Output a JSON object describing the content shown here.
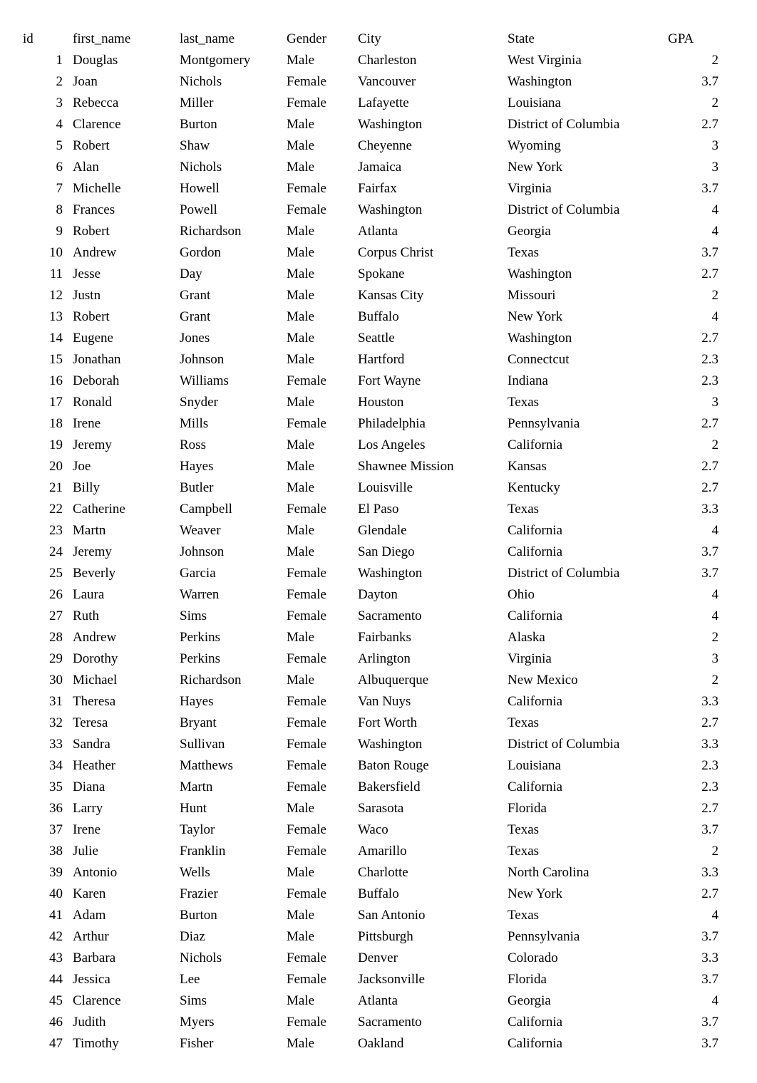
{
  "headers": {
    "id": "id",
    "first_name": "first_name",
    "last_name": "last_name",
    "gender": "Gender",
    "city": "City",
    "state": "State",
    "gpa": "GPA"
  },
  "rows": [
    {
      "id": "1",
      "first_name": "Douglas",
      "last_name": "Montgomery",
      "gender": "Male",
      "city": "Charleston",
      "state": "West Virginia",
      "gpa": "2"
    },
    {
      "id": "2",
      "first_name": "Joan",
      "last_name": "Nichols",
      "gender": "Female",
      "city": "Vancouver",
      "state": "Washington",
      "gpa": "3.7"
    },
    {
      "id": "3",
      "first_name": "Rebecca",
      "last_name": "Miller",
      "gender": "Female",
      "city": "Lafayette",
      "state": "Louisiana",
      "gpa": "2"
    },
    {
      "id": "4",
      "first_name": "Clarence",
      "last_name": "Burton",
      "gender": "Male",
      "city": "Washington",
      "state": "District of Columbia",
      "gpa": "2.7"
    },
    {
      "id": "5",
      "first_name": "Robert",
      "last_name": "Shaw",
      "gender": "Male",
      "city": "Cheyenne",
      "state": "Wyoming",
      "gpa": "3"
    },
    {
      "id": "6",
      "first_name": "Alan",
      "last_name": "Nichols",
      "gender": "Male",
      "city": "Jamaica",
      "state": "New York",
      "gpa": "3"
    },
    {
      "id": "7",
      "first_name": "Michelle",
      "last_name": "Howell",
      "gender": "Female",
      "city": "Fairfax",
      "state": "Virginia",
      "gpa": "3.7"
    },
    {
      "id": "8",
      "first_name": "Frances",
      "last_name": "Powell",
      "gender": "Female",
      "city": "Washington",
      "state": "District of Columbia",
      "gpa": "4"
    },
    {
      "id": "9",
      "first_name": "Robert",
      "last_name": "Richardson",
      "gender": "Male",
      "city": "Atlanta",
      "state": "Georgia",
      "gpa": "4"
    },
    {
      "id": "10",
      "first_name": "Andrew",
      "last_name": "Gordon",
      "gender": "Male",
      "city": "Corpus Christ",
      "state": "Texas",
      "gpa": "3.7"
    },
    {
      "id": "11",
      "first_name": "Jesse",
      "last_name": "Day",
      "gender": "Male",
      "city": "Spokane",
      "state": "Washington",
      "gpa": "2.7"
    },
    {
      "id": "12",
      "first_name": "Justn",
      "last_name": "Grant",
      "gender": "Male",
      "city": "Kansas City",
      "state": "Missouri",
      "gpa": "2"
    },
    {
      "id": "13",
      "first_name": "Robert",
      "last_name": "Grant",
      "gender": "Male",
      "city": "Buffalo",
      "state": "New York",
      "gpa": "4"
    },
    {
      "id": "14",
      "first_name": "Eugene",
      "last_name": "Jones",
      "gender": "Male",
      "city": "Seattle",
      "state": "Washington",
      "gpa": "2.7"
    },
    {
      "id": "15",
      "first_name": "Jonathan",
      "last_name": "Johnson",
      "gender": "Male",
      "city": "Hartford",
      "state": "Connectcut",
      "gpa": "2.3"
    },
    {
      "id": "16",
      "first_name": "Deborah",
      "last_name": "Williams",
      "gender": "Female",
      "city": "Fort Wayne",
      "state": "Indiana",
      "gpa": "2.3"
    },
    {
      "id": "17",
      "first_name": "Ronald",
      "last_name": "Snyder",
      "gender": "Male",
      "city": "Houston",
      "state": "Texas",
      "gpa": "3"
    },
    {
      "id": "18",
      "first_name": "Irene",
      "last_name": "Mills",
      "gender": "Female",
      "city": "Philadelphia",
      "state": "Pennsylvania",
      "gpa": "2.7"
    },
    {
      "id": "19",
      "first_name": "Jeremy",
      "last_name": "Ross",
      "gender": "Male",
      "city": "Los Angeles",
      "state": "California",
      "gpa": "2"
    },
    {
      "id": "20",
      "first_name": "Joe",
      "last_name": "Hayes",
      "gender": "Male",
      "city": "Shawnee Mission",
      "state": "Kansas",
      "gpa": "2.7"
    },
    {
      "id": "21",
      "first_name": "Billy",
      "last_name": "Butler",
      "gender": "Male",
      "city": "Louisville",
      "state": "Kentucky",
      "gpa": "2.7"
    },
    {
      "id": "22",
      "first_name": "Catherine",
      "last_name": "Campbell",
      "gender": "Female",
      "city": "El Paso",
      "state": "Texas",
      "gpa": "3.3"
    },
    {
      "id": "23",
      "first_name": "Martn",
      "last_name": "Weaver",
      "gender": "Male",
      "city": "Glendale",
      "state": "California",
      "gpa": "4"
    },
    {
      "id": "24",
      "first_name": "Jeremy",
      "last_name": "Johnson",
      "gender": "Male",
      "city": "San Diego",
      "state": "California",
      "gpa": "3.7"
    },
    {
      "id": "25",
      "first_name": "Beverly",
      "last_name": "Garcia",
      "gender": "Female",
      "city": "Washington",
      "state": "District of Columbia",
      "gpa": "3.7"
    },
    {
      "id": "26",
      "first_name": "Laura",
      "last_name": "Warren",
      "gender": "Female",
      "city": "Dayton",
      "state": "Ohio",
      "gpa": "4"
    },
    {
      "id": "27",
      "first_name": "Ruth",
      "last_name": "Sims",
      "gender": "Female",
      "city": "Sacramento",
      "state": "California",
      "gpa": "4"
    },
    {
      "id": "28",
      "first_name": "Andrew",
      "last_name": "Perkins",
      "gender": "Male",
      "city": "Fairbanks",
      "state": "Alaska",
      "gpa": "2"
    },
    {
      "id": "29",
      "first_name": "Dorothy",
      "last_name": "Perkins",
      "gender": "Female",
      "city": "Arlington",
      "state": "Virginia",
      "gpa": "3"
    },
    {
      "id": "30",
      "first_name": "Michael",
      "last_name": "Richardson",
      "gender": "Male",
      "city": "Albuquerque",
      "state": "New Mexico",
      "gpa": "2"
    },
    {
      "id": "31",
      "first_name": "Theresa",
      "last_name": "Hayes",
      "gender": "Female",
      "city": "Van Nuys",
      "state": "California",
      "gpa": "3.3"
    },
    {
      "id": "32",
      "first_name": "Teresa",
      "last_name": "Bryant",
      "gender": "Female",
      "city": "Fort Worth",
      "state": "Texas",
      "gpa": "2.7"
    },
    {
      "id": "33",
      "first_name": "Sandra",
      "last_name": "Sullivan",
      "gender": "Female",
      "city": "Washington",
      "state": "District of Columbia",
      "gpa": "3.3"
    },
    {
      "id": "34",
      "first_name": "Heather",
      "last_name": "Matthews",
      "gender": "Female",
      "city": "Baton Rouge",
      "state": "Louisiana",
      "gpa": "2.3"
    },
    {
      "id": "35",
      "first_name": "Diana",
      "last_name": "Martn",
      "gender": "Female",
      "city": "Bakersfield",
      "state": "California",
      "gpa": "2.3"
    },
    {
      "id": "36",
      "first_name": "Larry",
      "last_name": "Hunt",
      "gender": "Male",
      "city": "Sarasota",
      "state": "Florida",
      "gpa": "2.7"
    },
    {
      "id": "37",
      "first_name": "Irene",
      "last_name": "Taylor",
      "gender": "Female",
      "city": "Waco",
      "state": "Texas",
      "gpa": "3.7"
    },
    {
      "id": "38",
      "first_name": "Julie",
      "last_name": "Franklin",
      "gender": "Female",
      "city": "Amarillo",
      "state": "Texas",
      "gpa": "2"
    },
    {
      "id": "39",
      "first_name": "Antonio",
      "last_name": "Wells",
      "gender": "Male",
      "city": "Charlotte",
      "state": "North Carolina",
      "gpa": "3.3"
    },
    {
      "id": "40",
      "first_name": "Karen",
      "last_name": "Frazier",
      "gender": "Female",
      "city": "Buffalo",
      "state": "New York",
      "gpa": "2.7"
    },
    {
      "id": "41",
      "first_name": "Adam",
      "last_name": "Burton",
      "gender": "Male",
      "city": "San Antonio",
      "state": "Texas",
      "gpa": "4"
    },
    {
      "id": "42",
      "first_name": "Arthur",
      "last_name": "Diaz",
      "gender": "Male",
      "city": "Pittsburgh",
      "state": "Pennsylvania",
      "gpa": "3.7"
    },
    {
      "id": "43",
      "first_name": "Barbara",
      "last_name": "Nichols",
      "gender": "Female",
      "city": "Denver",
      "state": "Colorado",
      "gpa": "3.3"
    },
    {
      "id": "44",
      "first_name": "Jessica",
      "last_name": "Lee",
      "gender": "Female",
      "city": "Jacksonville",
      "state": "Florida",
      "gpa": "3.7"
    },
    {
      "id": "45",
      "first_name": "Clarence",
      "last_name": "Sims",
      "gender": "Male",
      "city": "Atlanta",
      "state": "Georgia",
      "gpa": "4"
    },
    {
      "id": "46",
      "first_name": "Judith",
      "last_name": "Myers",
      "gender": "Female",
      "city": "Sacramento",
      "state": "California",
      "gpa": "3.7"
    },
    {
      "id": "47",
      "first_name": "Timothy",
      "last_name": "Fisher",
      "gender": "Male",
      "city": "Oakland",
      "state": "California",
      "gpa": "3.7"
    }
  ]
}
